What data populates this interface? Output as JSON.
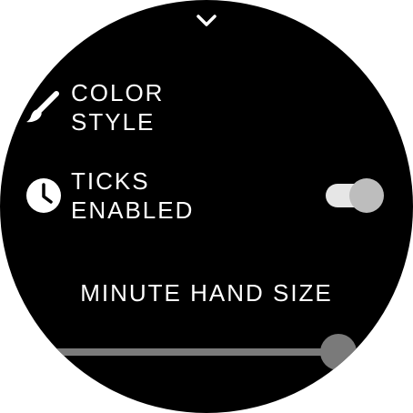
{
  "top_nav": {
    "icon": "chevron-down-icon"
  },
  "settings": [
    {
      "icon": "paintbrush-icon",
      "label_line1": "COLOR",
      "label_line2": "STYLE"
    },
    {
      "icon": "clock-icon",
      "label_line1": "TICKS",
      "label_line2": "ENABLED",
      "toggle_on": true
    }
  ],
  "minute_hand": {
    "title": "MINUTE HAND SIZE",
    "slider_value_fraction": 0.82
  },
  "colors": {
    "background": "#000000",
    "text": "#ffffff",
    "toggle_track": "#e6e6e6",
    "toggle_thumb": "#bdbdbd",
    "slider": "#7a7a7a"
  }
}
